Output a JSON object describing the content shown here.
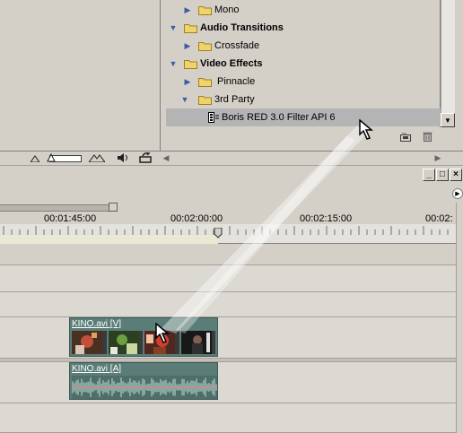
{
  "effects_panel": {
    "items": [
      {
        "label": "Mono",
        "bold": false,
        "expanded": false,
        "level": 1
      },
      {
        "label": "Audio Transitions",
        "bold": true,
        "expanded": true,
        "level": 0
      },
      {
        "label": "Crossfade",
        "bold": false,
        "expanded": false,
        "level": 1
      },
      {
        "label": "Video Effects",
        "bold": true,
        "expanded": true,
        "level": 0
      },
      {
        "label": "Pinnacle",
        "bold": false,
        "expanded": false,
        "level": 1
      },
      {
        "label": "3rd Party",
        "bold": false,
        "expanded": true,
        "level": 1
      },
      {
        "label": "Boris RED 3.0 Filter API 6",
        "bold": false,
        "selected": true,
        "level": 2
      }
    ],
    "icons": {
      "new_bin": "new-bin-icon",
      "delete": "trash-icon"
    }
  },
  "toolbar": {
    "icons": [
      "zoom-out-icon",
      "zoom-slider",
      "zoom-in-icon",
      "audio-icon",
      "export-icon"
    ]
  },
  "timeline": {
    "window_buttons": {
      "minimize": "_",
      "maximize": "□",
      "close": "×"
    },
    "timecodes": [
      "00:01:45:00",
      "00:02:00:00",
      "00:02:15:00",
      "00:02:"
    ],
    "video_clip": {
      "label": "KINO.avi [V]"
    },
    "audio_clip": {
      "label": "KINO.avi [A]"
    }
  },
  "colors": {
    "panel_bg": "#d4d0c8",
    "clip": "#5a7d78",
    "selection": "#b4b4b4",
    "tree_arrow": "#3b5aa8",
    "folder": "#e8c84a"
  }
}
